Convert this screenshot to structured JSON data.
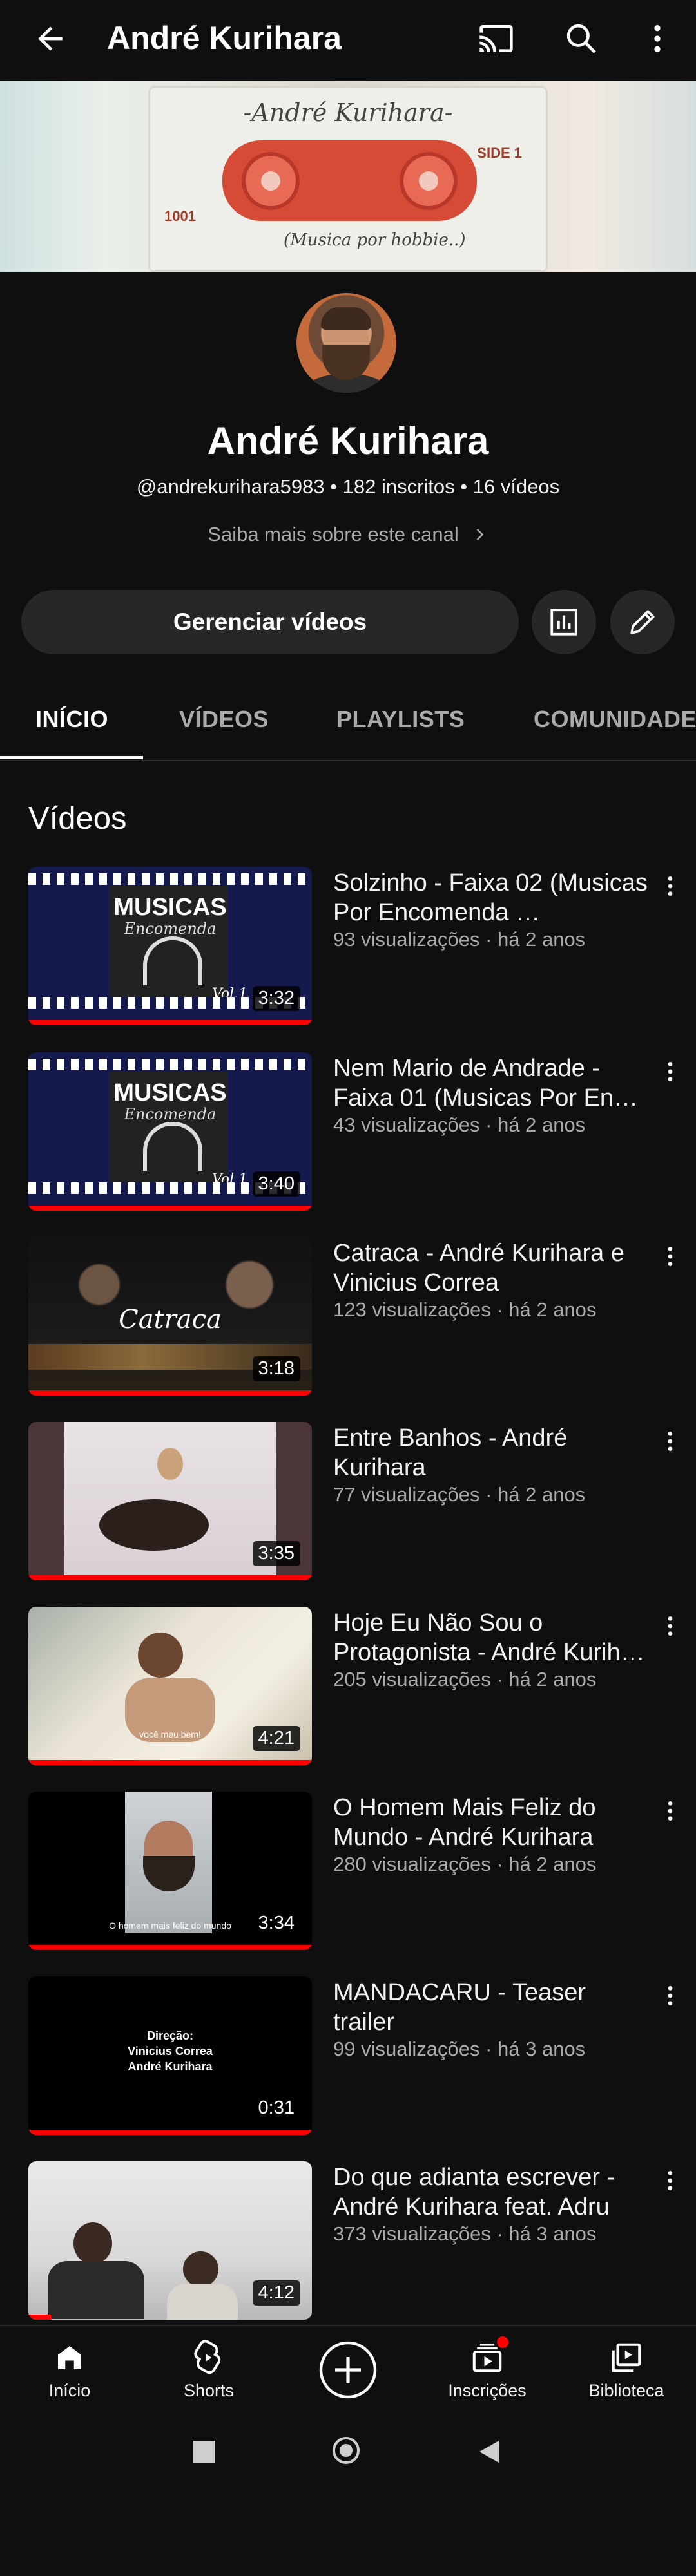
{
  "header": {
    "title": "André Kurihara"
  },
  "banner": {
    "cassette_title": "-André Kurihara-",
    "side_label": "SIDE 1",
    "cassette_number": "1001",
    "handwritten_note": "(Musica por hobbie..)"
  },
  "channel": {
    "name": "André Kurihara",
    "meta": "@andrekurihara5983 • 182 inscritos • 16 vídeos",
    "more_link": "Saiba mais sobre este canal",
    "manage_button": "Gerenciar vídeos"
  },
  "tabs": [
    "INÍCIO",
    "VÍDEOS",
    "PLAYLISTS",
    "COMUNIDADE"
  ],
  "section_title": "Vídeos",
  "videos": [
    {
      "title": "Solzinho - Faixa 02 (Musicas Por Encomenda …",
      "meta": "93 visualizações · há 2 anos",
      "duration": "3:32",
      "thumb_text": [
        "MUSICAS",
        "Encomenda",
        "Vol.1"
      ]
    },
    {
      "title": "Nem Mario de Andrade - Faixa 01 (Musicas Por En…",
      "meta": "43 visualizações · há 2 anos",
      "duration": "3:40",
      "thumb_text": [
        "MUSICAS",
        "Encomenda",
        "Vol.1"
      ]
    },
    {
      "title": "Catraca - André Kurihara e Vinicius Correa",
      "meta": "123 visualizações · há 2 anos",
      "duration": "3:18",
      "thumb_text": [
        "Catraca"
      ]
    },
    {
      "title": "Entre Banhos - André Kurihara",
      "meta": "77 visualizações · há 2 anos",
      "duration": "3:35"
    },
    {
      "title": "Hoje Eu Não Sou o Protagonista - André Kurih…",
      "meta": "205 visualizações · há 2 anos",
      "duration": "4:21",
      "thumb_text": [
        "você meu bem!"
      ]
    },
    {
      "title": "O Homem Mais Feliz do Mundo - André Kurihara",
      "meta": "280 visualizações · há 2 anos",
      "duration": "3:34",
      "thumb_text": [
        "O homem mais feliz do mundo"
      ]
    },
    {
      "title": "MANDACARU - Teaser trailer",
      "meta": "99 visualizações · há 3 anos",
      "duration": "0:31",
      "thumb_text": [
        "Direção:",
        "Vinicius Correa",
        "André Kurihara"
      ]
    },
    {
      "title": "Do que adianta escrever - André Kurihara feat. Adru",
      "meta": "373 visualizações · há 3 anos",
      "duration": "4:12"
    }
  ],
  "bottom_nav": [
    {
      "label": "Início",
      "icon": "home-icon"
    },
    {
      "label": "Shorts",
      "icon": "shorts-icon"
    },
    {
      "label": "",
      "icon": "create-icon"
    },
    {
      "label": "Inscrições",
      "icon": "subscriptions-icon"
    },
    {
      "label": "Biblioteca",
      "icon": "library-icon"
    }
  ],
  "colors": {
    "background": "#0f0f0f",
    "chip": "#272727",
    "progress": "#ff0000",
    "notification_dot": "#ff0000"
  }
}
